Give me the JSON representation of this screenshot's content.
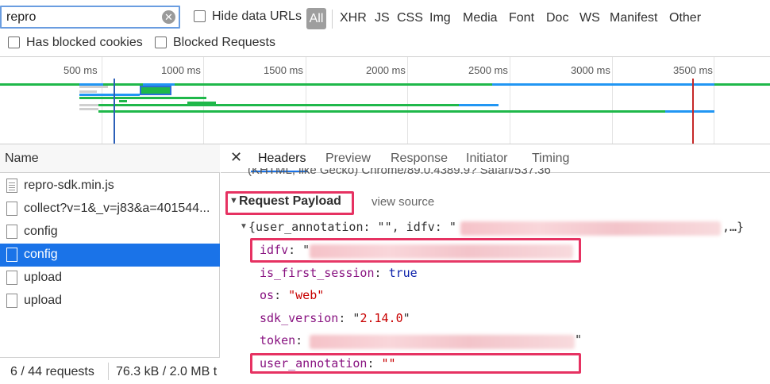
{
  "filter": {
    "search_value": "repro",
    "hide_data_urls_label": "Hide data URLs",
    "types": [
      "All",
      "XHR",
      "JS",
      "CSS",
      "Img",
      "Media",
      "Font",
      "Doc",
      "WS",
      "Manifest",
      "Other"
    ],
    "has_blocked_cookies_label": "Has blocked cookies",
    "blocked_requests_label": "Blocked Requests"
  },
  "timeline": {
    "ticks": [
      "500 ms",
      "1000 ms",
      "1500 ms",
      "2000 ms",
      "2500 ms",
      "3000 ms",
      "3500 ms"
    ]
  },
  "requests": {
    "header": "Name",
    "items": [
      {
        "name": "repro-sdk.min.js"
      },
      {
        "name": "collect?v=1&_v=j83&a=401544..."
      },
      {
        "name": "config"
      },
      {
        "name": "config"
      },
      {
        "name": "upload"
      },
      {
        "name": "upload"
      }
    ],
    "summary_count": "6 / 44 requests",
    "summary_size": "76.3 kB / 2.0 MB t"
  },
  "details": {
    "tabs": [
      "Headers",
      "Preview",
      "Response",
      "Initiator",
      "Timing"
    ],
    "clipped_header_text": "(KHTML, like Gecko) Chrome/89.0.4389.9? Safari/537.36",
    "payload_title": "Request Payload",
    "view_source": "view source",
    "summary_prefix": "{user_annotation: \"\", idfv: \"",
    "summary_suffix": ",…}",
    "fields": {
      "idfv_key": "idfv",
      "is_first_session_key": "is_first_session",
      "is_first_session_val": "true",
      "os_key": "os",
      "os_val": "\"web\"",
      "sdk_version_key": "sdk_version",
      "sdk_version_val": "2.14.0",
      "token_key": "token",
      "user_annotation_key": "user_annotation",
      "user_annotation_val": "\"\""
    }
  },
  "colors": {
    "selected_row": "#1a73e8",
    "highlight_box": "#e63262",
    "key_color": "#881280",
    "string_color": "#c80000"
  }
}
